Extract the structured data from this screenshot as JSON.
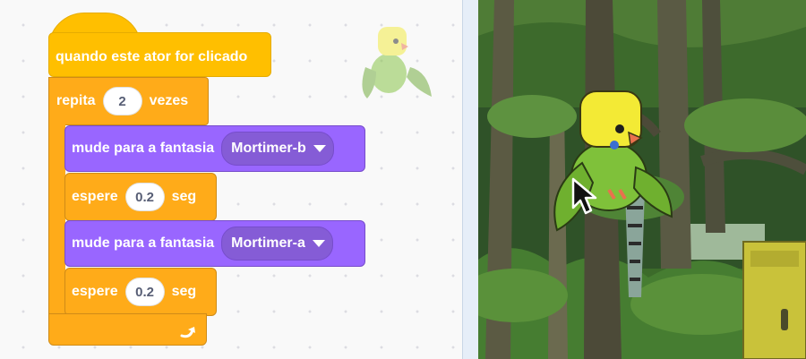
{
  "script": {
    "hat_label": "quando este ator for clicado",
    "repeat": {
      "label_before": "repita",
      "count": "2",
      "label_after": "vezes"
    },
    "steps": [
      {
        "type": "switch_costume",
        "label": "mude para a fantasia",
        "costume": "Mortimer-b"
      },
      {
        "type": "wait",
        "label": "espere",
        "value": "0.2",
        "unit": "seg"
      },
      {
        "type": "switch_costume",
        "label": "mude para a fantasia",
        "costume": "Mortimer-a"
      },
      {
        "type": "wait",
        "label": "espere",
        "value": "0.2",
        "unit": "seg"
      }
    ]
  },
  "colors": {
    "events": "#ffbf00",
    "control": "#ffab19",
    "looks": "#9966ff",
    "stage_accent": "#e6eef8"
  },
  "icons": [
    "loop-arrow-icon",
    "dropdown-caret-icon",
    "mouse-cursor-icon"
  ],
  "sprite": {
    "name": "budgie-sprite"
  }
}
